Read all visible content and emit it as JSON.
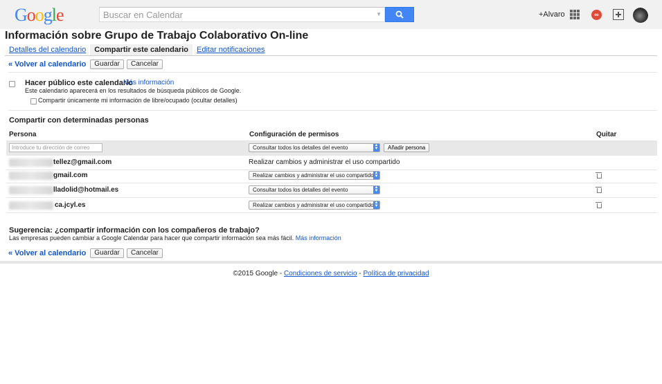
{
  "header": {
    "logo_letters": [
      {
        "ch": "G",
        "color": "#4285f4"
      },
      {
        "ch": "o",
        "color": "#ea4335"
      },
      {
        "ch": "o",
        "color": "#fbbc05"
      },
      {
        "ch": "g",
        "color": "#4285f4"
      },
      {
        "ch": "l",
        "color": "#34a853"
      },
      {
        "ch": "e",
        "color": "#ea4335"
      }
    ],
    "search_placeholder": "Buscar en Calendar",
    "user_label": "+Alvaro",
    "notification_count": "∞"
  },
  "page": {
    "title": "Información sobre Grupo de Trabajo Colaborativo On-line",
    "tabs": [
      {
        "label": "Detalles del calendario",
        "active": false
      },
      {
        "label": "Compartir este calendario",
        "active": true
      },
      {
        "label": "Editar notificaciones",
        "active": false
      }
    ]
  },
  "actions": {
    "back": "« Volver al calendario",
    "save": "Guardar",
    "cancel": "Cancelar"
  },
  "public": {
    "label": "Hacer público este calendario",
    "more": "Más información",
    "description": "Este calendario aparecerá en los resultados de búsqueda públicos de Google.",
    "busy_only": "Compartir únicamente mi información de libre/ocupado (ocultar detalles)"
  },
  "sharing": {
    "title": "Compartir con determinadas personas",
    "columns": {
      "person": "Persona",
      "permissions": "Configuración de permisos",
      "remove": "Quitar"
    },
    "add": {
      "email_placeholder": "Introduce tu dirección de correo",
      "permission": "Consultar todos los detalles del evento",
      "button": "Añadir persona"
    },
    "people": [
      {
        "email": "tellez@gmail.com",
        "permission": "Realizar cambios y administrar el uso compartido",
        "editable": false
      },
      {
        "email": "gmail.com",
        "permission": "Realizar cambios y administrar el uso compartido",
        "editable": true
      },
      {
        "email": "lladolid@hotmail.es",
        "permission": "Consultar todos los detalles del evento",
        "editable": true
      },
      {
        "email": "ca.jcyl.es",
        "permission": "Realizar cambios y administrar el uso compartido",
        "editable": true
      }
    ]
  },
  "tip": {
    "title": "Sugerencia: ¿compartir información con los compañeros de trabajo?",
    "text": "Las empresas pueden cambiar a Google Calendar para hacer que compartir información sea más fácil.",
    "link": "Más información"
  },
  "footer": {
    "copyright": "©2015 Google -",
    "terms": "Condiciones de servicio",
    "dash": "-",
    "privacy": "Política de privacidad"
  }
}
